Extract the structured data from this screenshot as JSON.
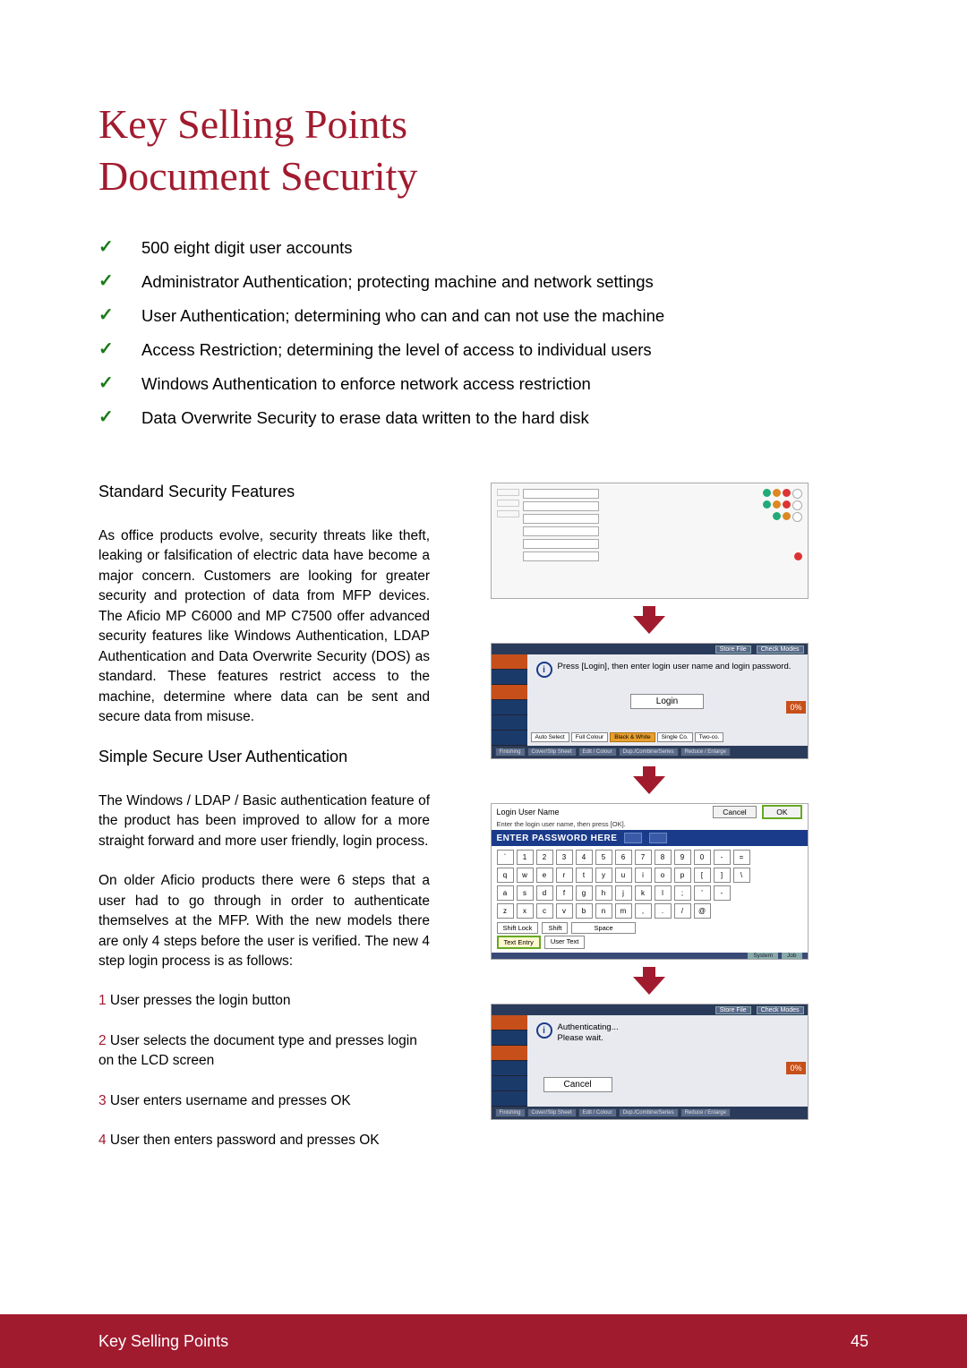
{
  "title_line1": "Key Selling Points",
  "title_line2": "Document Security",
  "checklist": [
    "500 eight digit user accounts",
    "Administrator Authentication; protecting machine and network settings",
    "User Authentication; determining who can and can not use the machine",
    "Access Restriction; determining the level of access  to individual users",
    "Windows Authentication to enforce network access restriction",
    "Data Overwrite Security to erase data written to the hard disk"
  ],
  "left": {
    "sub1": "Standard Security Features",
    "p1": "As office products evolve, security threats like theft, leaking or falsification of electric data have become a major concern. Customers are looking for greater security and protection of data from MFP devices. The Aficio MP C6000 and MP C7500 offer advanced security features like Windows Authentication, LDAP Authentication and Data Overwrite Security (DOS) as standard. These features restrict access to the machine, determine where data can be sent and secure data from misuse.",
    "sub2": "Simple Secure User Authentication",
    "p2": "The Windows / LDAP / Basic authentication feature of the product has been improved to allow for a more straight forward and more user friendly, login process.",
    "p3": "On older Aficio products there were 6 steps that a user had to go through in order to authenticate themselves at the MFP. With  the new models there are only 4 steps before the user is verified. The new 4 step login process is as follows:",
    "steps": [
      {
        "n": "1",
        "t": " User presses the login button"
      },
      {
        "n": "2",
        "t": " User selects the document type and presses login on the LCD screen"
      },
      {
        "n": "3",
        "t": " User enters username and presses OK"
      },
      {
        "n": "4",
        "t": " User then enters password and presses OK"
      }
    ]
  },
  "screens": {
    "s2": {
      "top_store": "Store File",
      "top_check": "Check Modes",
      "info": "Press [Login], then enter login user name and login password.",
      "login": "Login",
      "pct": "0%",
      "tabs": [
        "Auto Select",
        "Full Colour",
        "Black & White",
        "Single Co.",
        "Two-co."
      ],
      "bottom": [
        "Finishing",
        "Cover/Slip Sheet",
        "Edit / Colour",
        "Dup./Combine/Series",
        "Reduce / Enlarge"
      ]
    },
    "s3": {
      "label": "Login User Name",
      "hint": "Enter the login user name, then press [OK].",
      "cancel": "Cancel",
      "ok": "OK",
      "bar": "ENTER PASSWORD HERE",
      "rows": [
        [
          "`",
          "1",
          "2",
          "3",
          "4",
          "5",
          "6",
          "7",
          "8",
          "9",
          "0",
          "-",
          "="
        ],
        [
          "q",
          "w",
          "e",
          "r",
          "t",
          "y",
          "u",
          "i",
          "o",
          "p",
          "[",
          "]",
          "\\"
        ],
        [
          "a",
          "s",
          "d",
          "f",
          "g",
          "h",
          "j",
          "k",
          "l",
          ";",
          "'",
          "-"
        ],
        [
          "z",
          "x",
          "c",
          "v",
          "b",
          "n",
          "m",
          ",",
          ".",
          "/",
          "@"
        ]
      ],
      "bot": [
        "Shift Lock",
        "Shift",
        "Space"
      ],
      "te": "Text Entry",
      "ut": "User Text"
    },
    "s4": {
      "top_store": "Store File",
      "top_check": "Check Modes",
      "auth": "Authenticating...",
      "wait": "Please wait.",
      "cancel": "Cancel",
      "pct": "0%",
      "bottom": [
        "Finishing",
        "Cover/Slip Sheet",
        "Edit / Colour",
        "Dup./Combine/Series",
        "Reduce / Enlarge"
      ]
    }
  },
  "footer": {
    "left": "Key Selling Points",
    "right": "45"
  }
}
